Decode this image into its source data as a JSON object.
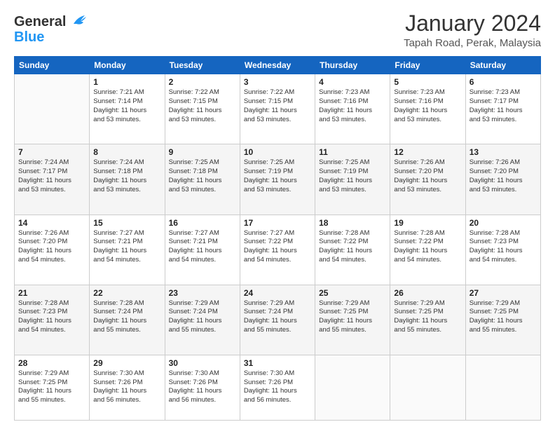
{
  "header": {
    "logo_line1": "General",
    "logo_line2": "Blue",
    "title": "January 2024",
    "subtitle": "Tapah Road, Perak, Malaysia"
  },
  "weekdays": [
    "Sunday",
    "Monday",
    "Tuesday",
    "Wednesday",
    "Thursday",
    "Friday",
    "Saturday"
  ],
  "weeks": [
    [
      {
        "day": "",
        "info": ""
      },
      {
        "day": "1",
        "info": "Sunrise: 7:21 AM\nSunset: 7:14 PM\nDaylight: 11 hours\nand 53 minutes."
      },
      {
        "day": "2",
        "info": "Sunrise: 7:22 AM\nSunset: 7:15 PM\nDaylight: 11 hours\nand 53 minutes."
      },
      {
        "day": "3",
        "info": "Sunrise: 7:22 AM\nSunset: 7:15 PM\nDaylight: 11 hours\nand 53 minutes."
      },
      {
        "day": "4",
        "info": "Sunrise: 7:23 AM\nSunset: 7:16 PM\nDaylight: 11 hours\nand 53 minutes."
      },
      {
        "day": "5",
        "info": "Sunrise: 7:23 AM\nSunset: 7:16 PM\nDaylight: 11 hours\nand 53 minutes."
      },
      {
        "day": "6",
        "info": "Sunrise: 7:23 AM\nSunset: 7:17 PM\nDaylight: 11 hours\nand 53 minutes."
      }
    ],
    [
      {
        "day": "7",
        "info": "Sunrise: 7:24 AM\nSunset: 7:17 PM\nDaylight: 11 hours\nand 53 minutes."
      },
      {
        "day": "8",
        "info": "Sunrise: 7:24 AM\nSunset: 7:18 PM\nDaylight: 11 hours\nand 53 minutes."
      },
      {
        "day": "9",
        "info": "Sunrise: 7:25 AM\nSunset: 7:18 PM\nDaylight: 11 hours\nand 53 minutes."
      },
      {
        "day": "10",
        "info": "Sunrise: 7:25 AM\nSunset: 7:19 PM\nDaylight: 11 hours\nand 53 minutes."
      },
      {
        "day": "11",
        "info": "Sunrise: 7:25 AM\nSunset: 7:19 PM\nDaylight: 11 hours\nand 53 minutes."
      },
      {
        "day": "12",
        "info": "Sunrise: 7:26 AM\nSunset: 7:20 PM\nDaylight: 11 hours\nand 53 minutes."
      },
      {
        "day": "13",
        "info": "Sunrise: 7:26 AM\nSunset: 7:20 PM\nDaylight: 11 hours\nand 53 minutes."
      }
    ],
    [
      {
        "day": "14",
        "info": "Sunrise: 7:26 AM\nSunset: 7:20 PM\nDaylight: 11 hours\nand 54 minutes."
      },
      {
        "day": "15",
        "info": "Sunrise: 7:27 AM\nSunset: 7:21 PM\nDaylight: 11 hours\nand 54 minutes."
      },
      {
        "day": "16",
        "info": "Sunrise: 7:27 AM\nSunset: 7:21 PM\nDaylight: 11 hours\nand 54 minutes."
      },
      {
        "day": "17",
        "info": "Sunrise: 7:27 AM\nSunset: 7:22 PM\nDaylight: 11 hours\nand 54 minutes."
      },
      {
        "day": "18",
        "info": "Sunrise: 7:28 AM\nSunset: 7:22 PM\nDaylight: 11 hours\nand 54 minutes."
      },
      {
        "day": "19",
        "info": "Sunrise: 7:28 AM\nSunset: 7:22 PM\nDaylight: 11 hours\nand 54 minutes."
      },
      {
        "day": "20",
        "info": "Sunrise: 7:28 AM\nSunset: 7:23 PM\nDaylight: 11 hours\nand 54 minutes."
      }
    ],
    [
      {
        "day": "21",
        "info": "Sunrise: 7:28 AM\nSunset: 7:23 PM\nDaylight: 11 hours\nand 54 minutes."
      },
      {
        "day": "22",
        "info": "Sunrise: 7:28 AM\nSunset: 7:24 PM\nDaylight: 11 hours\nand 55 minutes."
      },
      {
        "day": "23",
        "info": "Sunrise: 7:29 AM\nSunset: 7:24 PM\nDaylight: 11 hours\nand 55 minutes."
      },
      {
        "day": "24",
        "info": "Sunrise: 7:29 AM\nSunset: 7:24 PM\nDaylight: 11 hours\nand 55 minutes."
      },
      {
        "day": "25",
        "info": "Sunrise: 7:29 AM\nSunset: 7:25 PM\nDaylight: 11 hours\nand 55 minutes."
      },
      {
        "day": "26",
        "info": "Sunrise: 7:29 AM\nSunset: 7:25 PM\nDaylight: 11 hours\nand 55 minutes."
      },
      {
        "day": "27",
        "info": "Sunrise: 7:29 AM\nSunset: 7:25 PM\nDaylight: 11 hours\nand 55 minutes."
      }
    ],
    [
      {
        "day": "28",
        "info": "Sunrise: 7:29 AM\nSunset: 7:25 PM\nDaylight: 11 hours\nand 55 minutes."
      },
      {
        "day": "29",
        "info": "Sunrise: 7:30 AM\nSunset: 7:26 PM\nDaylight: 11 hours\nand 56 minutes."
      },
      {
        "day": "30",
        "info": "Sunrise: 7:30 AM\nSunset: 7:26 PM\nDaylight: 11 hours\nand 56 minutes."
      },
      {
        "day": "31",
        "info": "Sunrise: 7:30 AM\nSunset: 7:26 PM\nDaylight: 11 hours\nand 56 minutes."
      },
      {
        "day": "",
        "info": ""
      },
      {
        "day": "",
        "info": ""
      },
      {
        "day": "",
        "info": ""
      }
    ]
  ]
}
